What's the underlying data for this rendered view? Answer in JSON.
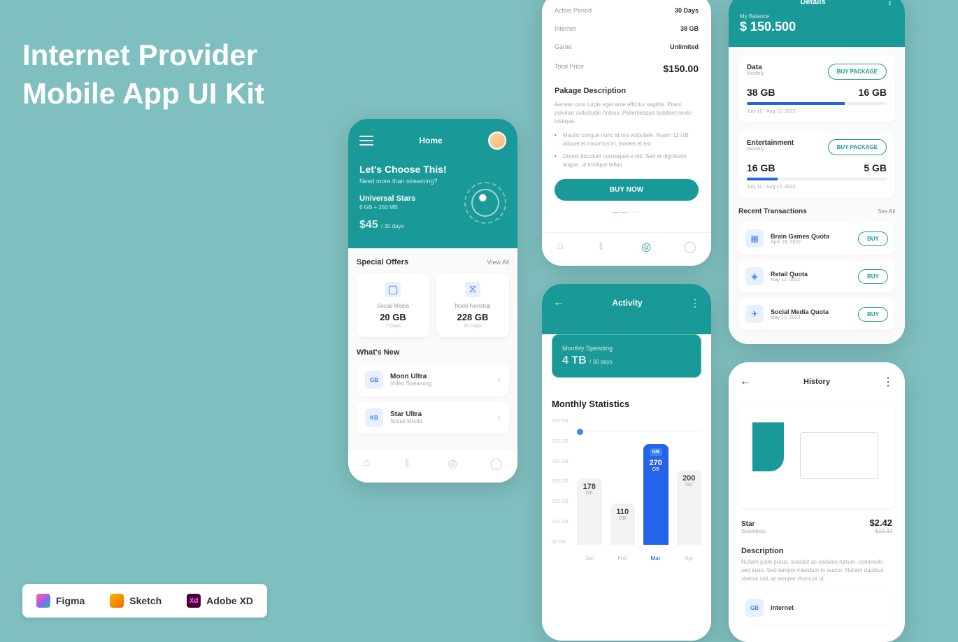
{
  "title": "Internet Provider\nMobile App UI Kit",
  "tools": [
    "Figma",
    "Sketch",
    "Adobe XD"
  ],
  "home": {
    "label": "Home",
    "choose": "Let's Choose This!",
    "sub": "Need more than streaming?",
    "plan": "Universal Stars",
    "plan_sub": "6 GB + 250 MB",
    "price": "$45",
    "period": "/ 30 days",
    "offers_title": "Special Offers",
    "offers_link": "View All",
    "offers": [
      {
        "name": "Social Media",
        "val": "20 GB",
        "days": "7 Days"
      },
      {
        "name": "Noob Nonstop",
        "val": "228 GB",
        "days": "30 Days"
      }
    ],
    "new_title": "What's New",
    "news": [
      {
        "badge": "GB",
        "name": "Moon Ultra",
        "sub": "Video Streaming"
      },
      {
        "badge": "KB",
        "name": "Star Ultra",
        "sub": "Social Media"
      }
    ]
  },
  "pkg": {
    "rows": [
      {
        "label": "Active Period",
        "val": "30 Days"
      },
      {
        "label": "Internet",
        "val": "38 GB"
      },
      {
        "label": "Game",
        "val": "Unlimited"
      }
    ],
    "total_label": "Total Price",
    "total": "$150.00",
    "desc_title": "Pakage Description",
    "desc": "Aenean quis turpis eget ante efficitur sagittis. Etiam pulvinar sollicitudin finibus. Pellentesque habitant morbi tristique.",
    "bullets": [
      "Mauris congue nunc id nra vulputate. Nuam 12 GB aliquet et maximus in, laoreet et est.",
      "Donec tincidunt consequat e elit. Sed at dignissim augue, ut tristique tellus."
    ],
    "buy": "BUY NOW"
  },
  "activity": {
    "title": "Activity",
    "sp_label": "Monthly Spending",
    "sp_val": "4 TB",
    "sp_period": "/ 30 days",
    "stats_title": "Monthly Statistics",
    "badge": "GB"
  },
  "chart_data": {
    "type": "bar",
    "categories": [
      "Jan",
      "Feb",
      "Mar",
      "Apr"
    ],
    "values": [
      178,
      110,
      270,
      200
    ],
    "unit": "GB",
    "ylabel": "",
    "ylim": [
      0,
      300
    ],
    "y_ticks": [
      "300 GB",
      "275 GB",
      "250 GB",
      "200 GB",
      "150 GB",
      "100 GB",
      "50 GB"
    ],
    "active_index": 2,
    "slider_value": 275
  },
  "details": {
    "title": "Details",
    "balance_label": "My Balance",
    "balance": "$ 150.500",
    "cards": [
      {
        "name": "Data",
        "sub": "Monthly",
        "btn": "BUY PACKAGE",
        "used": "38 GB",
        "left": "16 GB",
        "pct": 70,
        "date": "July 12 - Aug 12, 2022"
      },
      {
        "name": "Entertainment",
        "sub": "Monthly",
        "btn": "BUY PACKAGE",
        "used": "16 GB",
        "left": "5 GB",
        "pct": 22,
        "date": "July 12 - Aug 12, 2022"
      }
    ],
    "trans_title": "Recent Transactions",
    "trans_link": "See All",
    "trans": [
      {
        "name": "Brain Games Quota",
        "date": "April 18, 2022",
        "btn": "BUY"
      },
      {
        "name": "Retail Quota",
        "date": "May 12, 2022",
        "btn": "BUY"
      },
      {
        "name": "Social Media Quota",
        "date": "May 12, 2022",
        "btn": "BUY"
      }
    ]
  },
  "history": {
    "title": "History",
    "star": "Star",
    "star_sub": "Seamless",
    "price": "$2.42",
    "old_price": "$12.32",
    "desc_title": "Description",
    "desc": "Nullam justo purus, suscipit ac sodales rutrum, commodo sed justo. Sed tempor interdum m auctor. Nullam dapibus viverra nisi, at semper  rhoncus ut.",
    "internet_label": "Internet",
    "internet_badge": "GB"
  }
}
